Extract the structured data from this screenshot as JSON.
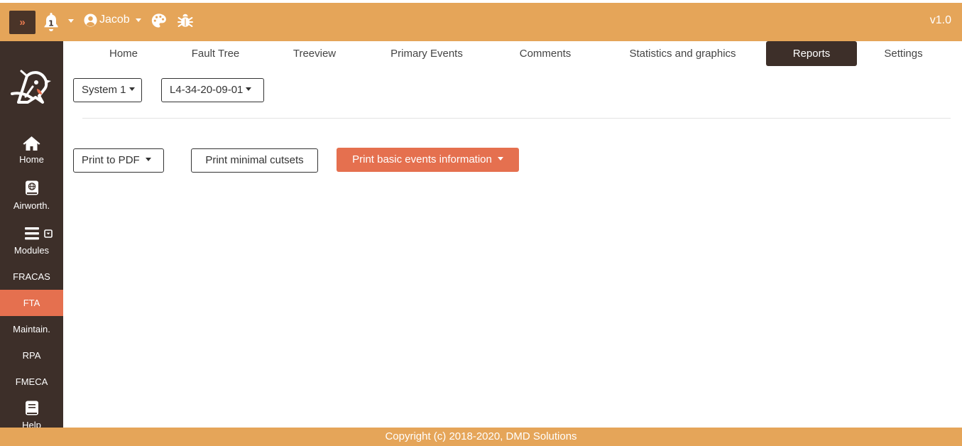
{
  "topbar": {
    "toggle_label": "»",
    "notification_count": "1",
    "user_name": "Jacob",
    "version": "v1.0"
  },
  "sidebar": {
    "items": [
      {
        "label": "Home",
        "icon": "home-icon"
      },
      {
        "label": "Airworth.",
        "icon": "book-globe-icon"
      },
      {
        "label": "Modules",
        "icon": "menu-icon"
      },
      {
        "label": "FRACAS"
      },
      {
        "label": "FTA"
      },
      {
        "label": "Maintain."
      },
      {
        "label": "RPA"
      },
      {
        "label": "FMECA"
      },
      {
        "label": "Help",
        "icon": "book-icon"
      }
    ],
    "active_item": "FTA"
  },
  "tabs": [
    {
      "label": "Home"
    },
    {
      "label": "Fault Tree"
    },
    {
      "label": "Treeview"
    },
    {
      "label": "Primary Events"
    },
    {
      "label": "Comments"
    },
    {
      "label": "Statistics and graphics"
    },
    {
      "label": "Reports"
    },
    {
      "label": "Settings"
    }
  ],
  "active_tab": "Reports",
  "selectors": {
    "system": "System 1",
    "fault_tree": "L4-34-20-09-01"
  },
  "actions": {
    "print_pdf": "Print to PDF",
    "print_cutsets": "Print minimal cutsets",
    "print_basic_events": "Print basic events information"
  },
  "footer": {
    "copyright": "Copyright (c) 2018-2020, DMD Solutions"
  },
  "colors": {
    "topbar": "#e5a559",
    "sidebar": "#3d2f29",
    "accent": "#e5704f"
  }
}
